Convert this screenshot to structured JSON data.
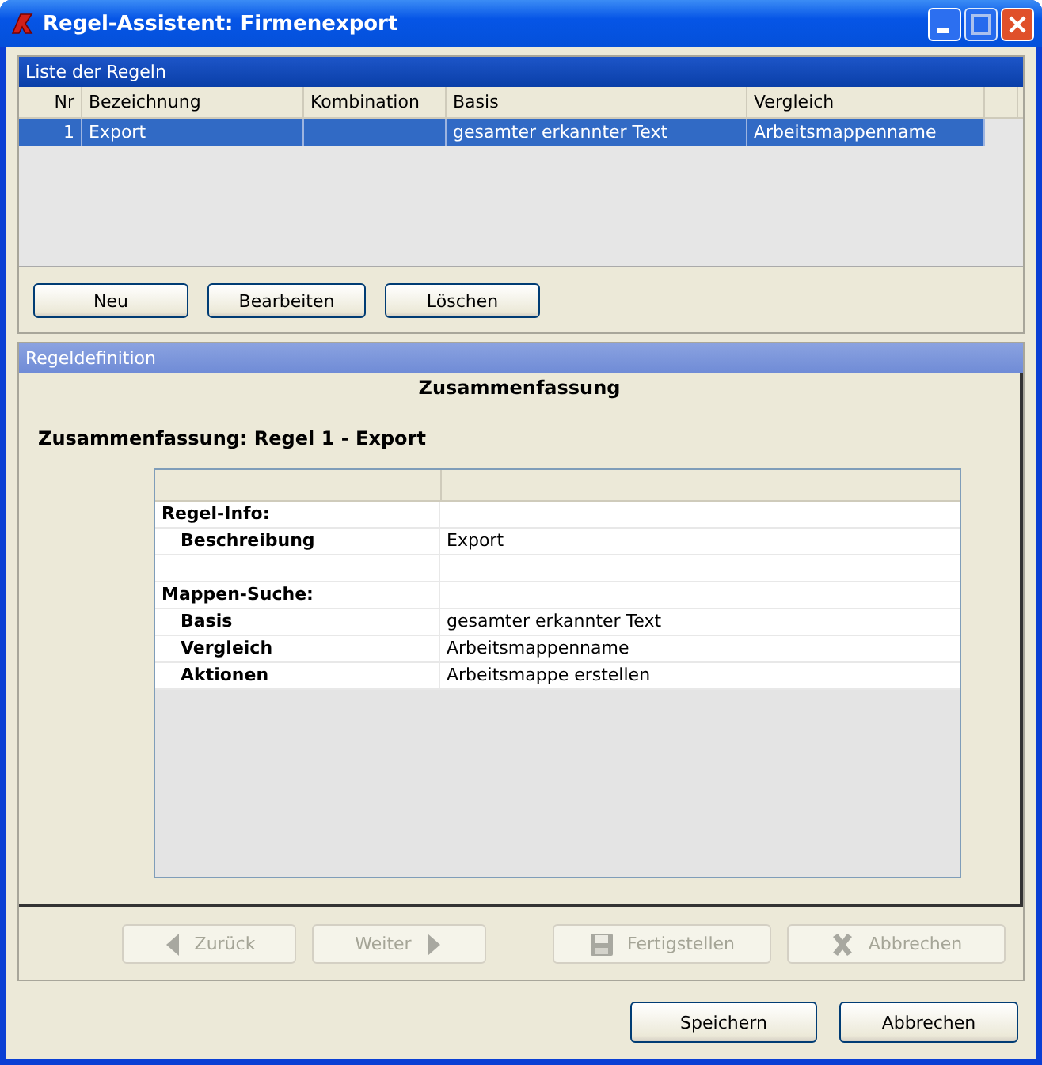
{
  "window": {
    "title": "Regel-Assistent: Firmenexport"
  },
  "rules_list": {
    "title": "Liste der Regeln",
    "columns": [
      "Nr",
      "Bezeichnung",
      "Kombination",
      "Basis",
      "Vergleich"
    ],
    "rows": [
      {
        "cells": [
          "1",
          "Export",
          "",
          "gesamter erkannter Text",
          "Arbeitsmappenname"
        ],
        "selected": true
      }
    ],
    "buttons": [
      "Neu",
      "Bearbeiten",
      "Löschen"
    ]
  },
  "definition": {
    "title": "Regeldefinition",
    "heading": "Zusammenfassung",
    "subtitle": "Zusammenfassung: Regel 1 - Export",
    "summary_rows": [
      {
        "kind": "section",
        "label": "Regel-Info:"
      },
      {
        "kind": "field",
        "label": "Beschreibung",
        "value": "Export"
      },
      {
        "kind": "spacer"
      },
      {
        "kind": "section",
        "label": "Mappen-Suche:"
      },
      {
        "kind": "field",
        "label": "Basis",
        "value": "gesamter erkannter Text"
      },
      {
        "kind": "field",
        "label": "Vergleich",
        "value": "Arbeitsmappenname"
      },
      {
        "kind": "field",
        "label": "Aktionen",
        "value": "Arbeitsmappe erstellen"
      }
    ],
    "wizard_buttons": [
      {
        "label": "Zurück",
        "kind": "back",
        "disabled": true
      },
      {
        "label": "Weiter",
        "kind": "next",
        "disabled": true
      },
      {
        "label": "Fertigstellen",
        "kind": "save",
        "disabled": true
      },
      {
        "label": "Abbrechen",
        "kind": "cancel",
        "disabled": true
      }
    ]
  },
  "footer_buttons": [
    "Speichern",
    "Abbrechen"
  ]
}
